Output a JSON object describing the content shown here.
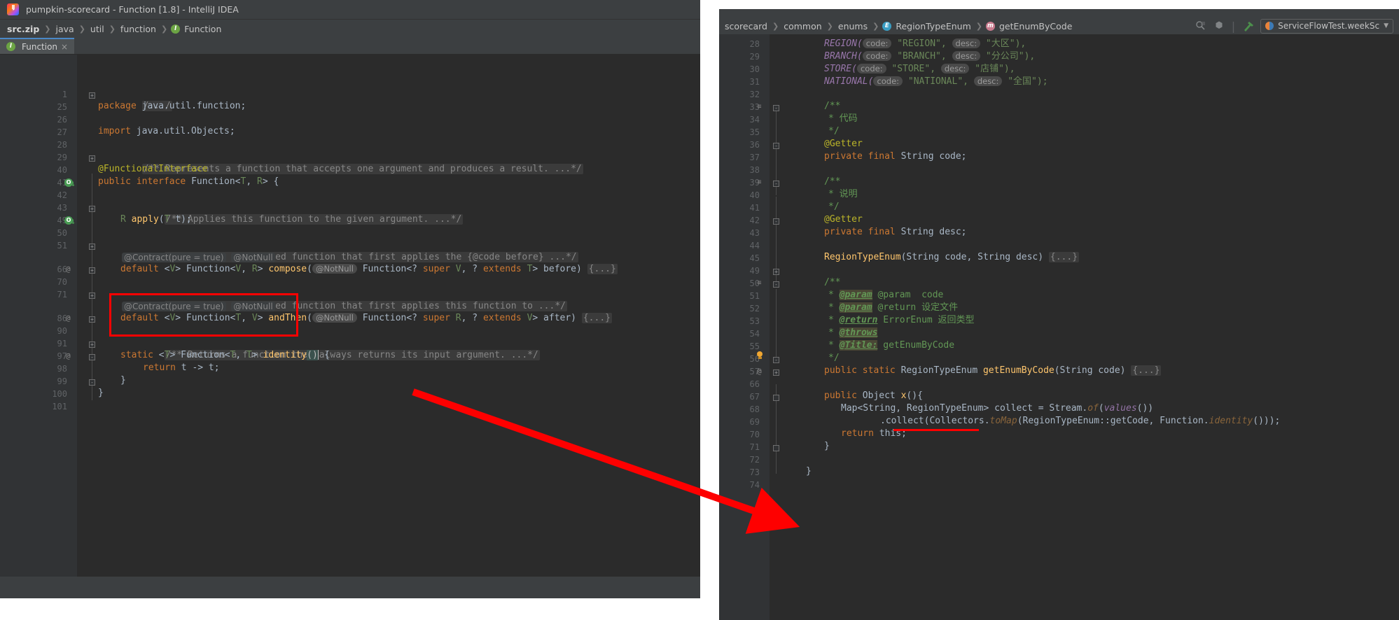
{
  "left_window": {
    "title": "pumpkin-scorecard - Function [1.8] - IntelliJ IDEA",
    "logo_label": "IJ",
    "breadcrumb": [
      {
        "label": "src.zip",
        "bold": true,
        "icon": ""
      },
      {
        "label": "java",
        "bold": false,
        "icon": ""
      },
      {
        "label": "util",
        "bold": false,
        "icon": ""
      },
      {
        "label": "function",
        "bold": false,
        "icon": ""
      },
      {
        "label": "Function",
        "bold": false,
        "icon": "interface-icon"
      }
    ],
    "tab": {
      "label": "Function",
      "icon": "interface-icon",
      "close": "×"
    },
    "lines": [
      {
        "num": "1",
        "gutter": "",
        "fold": "+"
      },
      {
        "num": "25",
        "gutter": "",
        "fold": ""
      },
      {
        "num": "26",
        "gutter": "",
        "fold": ""
      },
      {
        "num": "27",
        "gutter": "",
        "fold": ""
      },
      {
        "num": "28",
        "gutter": "",
        "fold": ""
      },
      {
        "num": "29",
        "gutter": "",
        "fold": "+"
      },
      {
        "num": "40",
        "gutter": "",
        "fold": ""
      },
      {
        "num": "41",
        "gutter": "override",
        "fold": ""
      },
      {
        "num": "42",
        "gutter": "",
        "fold": ""
      },
      {
        "num": "43",
        "gutter": "",
        "fold": "+"
      },
      {
        "num": "49",
        "gutter": "override",
        "fold": ""
      },
      {
        "num": "50",
        "gutter": "",
        "fold": ""
      },
      {
        "num": "51",
        "gutter": "",
        "fold": "+"
      },
      {
        "num": "66",
        "gutter": "@",
        "fold": "+"
      },
      {
        "num": "70",
        "gutter": "",
        "fold": ""
      },
      {
        "num": "71",
        "gutter": "",
        "fold": "+"
      },
      {
        "num": "86",
        "gutter": "@",
        "fold": "+"
      },
      {
        "num": "90",
        "gutter": "",
        "fold": ""
      },
      {
        "num": "91",
        "gutter": "",
        "fold": "+"
      },
      {
        "num": "97",
        "gutter": "@",
        "fold": "-"
      },
      {
        "num": "98",
        "gutter": "",
        "fold": ""
      },
      {
        "num": "99",
        "gutter": "",
        "fold": "-"
      },
      {
        "num": "100",
        "gutter": "",
        "fold": ""
      },
      {
        "num": "101",
        "gutter": "",
        "fold": ""
      }
    ],
    "code": {
      "l1_fold": "/.../",
      "l25": "package java.util.function;",
      "l27": "import java.util.Objects;",
      "l29_doc": "/** Represents a function that accepts one argument and produces a result. ...*/",
      "l40": "@FunctionalInterface",
      "l41": "public interface Function<T, R> {",
      "l43_doc": "/** Applies this function to the given argument. ...*/",
      "l49": "R apply(T t);",
      "l51_doc": "/** Returns a composed function that first applies the {@code before} ...*/",
      "hint_contract": "@Contract(pure = true)",
      "hint_notnull": "@NotNull",
      "l66": "default <V> Function<V, R> compose(",
      "l66_param": "@NotNull",
      "l66_rest": " Function<? super V, ? extends T> before) ",
      "l66_body": "{...}",
      "l71_doc": "/** Returns a composed function that first applies this function to ...*/",
      "l86": "default <V> Function<T, V> andThen(",
      "l86_param": "@NotNull",
      "l86_rest": " Function<? super R, ? extends V> after) ",
      "l86_body": "{...}",
      "l91_doc": "/** Returns a function that always returns its input argument. ...*/",
      "l97": "static <T> Function<T, T> identity() {",
      "l98": "return t -> t;",
      "l99": "}",
      "l100": "}"
    }
  },
  "right_window": {
    "breadcrumb": [
      {
        "label": "scorecard",
        "icon": ""
      },
      {
        "label": "common",
        "icon": ""
      },
      {
        "label": "enums",
        "icon": ""
      },
      {
        "label": "RegionTypeEnum",
        "icon": "enum-icon"
      },
      {
        "label": "getEnumByCode",
        "icon": "method-icon"
      }
    ],
    "toolbar": {
      "icons": [
        "search-everywhere-icon",
        "settings-icon",
        "hammer-icon"
      ],
      "run_config": "ServiceFlowTest.weekSc",
      "run_config_caret": "▼"
    },
    "lines": [
      {
        "num": "28",
        "fold": "",
        "struct": ""
      },
      {
        "num": "29",
        "fold": "",
        "struct": ""
      },
      {
        "num": "30",
        "fold": "",
        "struct": ""
      },
      {
        "num": "31",
        "fold": "",
        "struct": ""
      },
      {
        "num": "32",
        "fold": "",
        "struct": ""
      },
      {
        "num": "33",
        "fold": "-",
        "struct": "doc-icon"
      },
      {
        "num": "34",
        "fold": "",
        "struct": ""
      },
      {
        "num": "35",
        "fold": "-",
        "struct": ""
      },
      {
        "num": "36",
        "fold": "",
        "struct": ""
      },
      {
        "num": "37",
        "fold": "",
        "struct": ""
      },
      {
        "num": "38",
        "fold": "",
        "struct": ""
      },
      {
        "num": "39",
        "fold": "-",
        "struct": "doc-icon"
      },
      {
        "num": "40",
        "fold": "",
        "struct": ""
      },
      {
        "num": "41",
        "fold": "-",
        "struct": ""
      },
      {
        "num": "42",
        "fold": "",
        "struct": ""
      },
      {
        "num": "43",
        "fold": "",
        "struct": ""
      },
      {
        "num": "44",
        "fold": "",
        "struct": ""
      },
      {
        "num": "45",
        "fold": "+",
        "struct": ""
      },
      {
        "num": "49",
        "fold": "",
        "struct": ""
      },
      {
        "num": "50",
        "fold": "-",
        "struct": "doc-icon"
      },
      {
        "num": "51",
        "fold": "",
        "struct": ""
      },
      {
        "num": "52",
        "fold": "",
        "struct": ""
      },
      {
        "num": "53",
        "fold": "",
        "struct": ""
      },
      {
        "num": "54",
        "fold": "",
        "struct": ""
      },
      {
        "num": "55",
        "fold": "",
        "struct": ""
      },
      {
        "num": "56",
        "fold": "-",
        "struct": "bulb"
      },
      {
        "num": "57",
        "fold": "+",
        "struct": "@"
      },
      {
        "num": "66",
        "fold": "",
        "struct": ""
      },
      {
        "num": "67",
        "fold": "+",
        "struct": ""
      },
      {
        "num": "68",
        "fold": "",
        "struct": ""
      },
      {
        "num": "69",
        "fold": "",
        "struct": ""
      },
      {
        "num": "70",
        "fold": "",
        "struct": ""
      },
      {
        "num": "71",
        "fold": "-",
        "struct": ""
      },
      {
        "num": "72",
        "fold": "",
        "struct": ""
      },
      {
        "num": "73",
        "fold": "",
        "struct": ""
      },
      {
        "num": "74",
        "fold": "",
        "struct": ""
      }
    ],
    "code": {
      "enum_region_name": "REGION(",
      "enum_region_code_hint": "code:",
      "enum_region_code": " \"REGION\",",
      "enum_region_desc_hint": "desc:",
      "enum_region_desc": " \"大区\"),",
      "enum_branch_name": "BRANCH(",
      "enum_branch_code_hint": "code:",
      "enum_branch_code": " \"BRANCH\",",
      "enum_branch_desc_hint": "desc:",
      "enum_branch_desc": " \"分公司\"),",
      "enum_store_name": "STORE(",
      "enum_store_code_hint": "code:",
      "enum_store_code": " \"STORE\",",
      "enum_store_desc_hint": "desc:",
      "enum_store_desc": " \"店铺\"),",
      "enum_national_name": "NATIONAL(",
      "enum_national_code_hint": "code:",
      "enum_national_code": " \"NATIONAL\",",
      "enum_national_desc_hint": "desc:",
      "enum_national_desc": " \"全国\");",
      "doc_open_1": "/**",
      "doc_line_code": "* 代码",
      "doc_close_1": "*/",
      "getter_1": "@Getter",
      "field_code": "private final String code;",
      "doc_open_2": "/**",
      "doc_line_desc": "* 说明",
      "doc_close_2": "*/",
      "getter_2": "@Getter",
      "field_desc": "private final String desc;",
      "ctor": "RegionTypeEnum(String code, String desc) ",
      "ctor_body": "{...}",
      "doc_open_3": "/**",
      "doc_param_tag": "@param",
      "doc_param_rest": " @param  code",
      "doc_param2_tag": "@param",
      "doc_param2_rest": " @return 设定文件",
      "doc_return_tag": "@return",
      "doc_return_rest": " ErrorEnum 返回类型",
      "doc_throws_tag": "@throws",
      "doc_title_tag": "@Title:",
      "doc_title_rest": " getEnumByCode",
      "doc_close_3": "*/",
      "method_sig": "public static RegionTypeEnum getEnumByCode(String code) ",
      "method_body": "{...}",
      "x_sig": "public Object x(){",
      "x_l68": "Map<String, RegionTypeEnum> collect = Stream.",
      "x_l68_of": "of",
      "x_l68_values": "(values())",
      "x_l69_a": ".collect(Collectors.",
      "x_l69_tomap": "toMap",
      "x_l69_b": "(RegionTypeEnum::getCode, Function.",
      "x_l69_identity": "identity",
      "x_l69_c": "()));",
      "x_l70": "return this;",
      "x_l71": "}",
      "x_l73": "}"
    }
  },
  "annotations": {
    "highlight_color": "#fe0000",
    "red_box_target": "identity-method-declaration",
    "red_underline_target": "function-identity-call",
    "arrow_from": "identity-method-declaration",
    "arrow_to": "function-identity-call"
  }
}
